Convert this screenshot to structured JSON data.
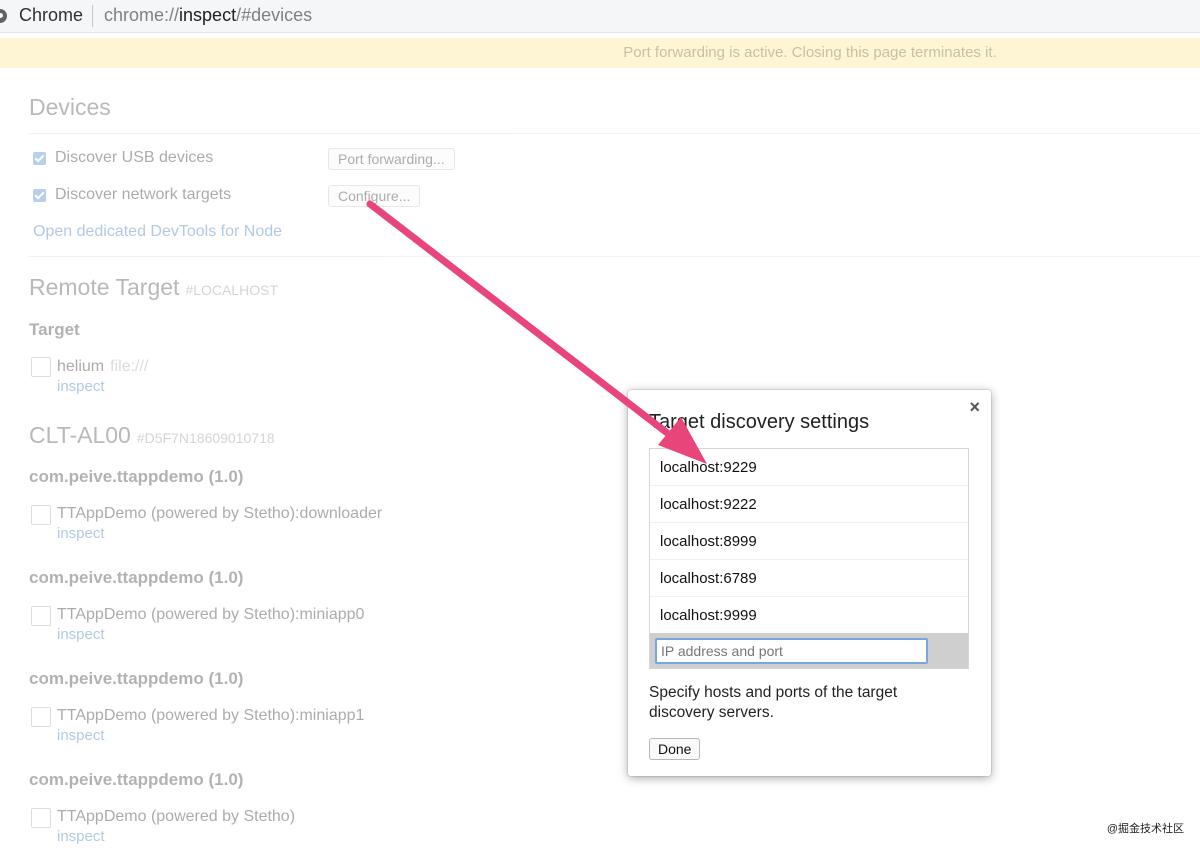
{
  "browser": {
    "name": "Chrome",
    "url_prefix": "chrome://",
    "url_host": "inspect",
    "url_path": "/#devices"
  },
  "banner": {
    "text": "Port forwarding is active. Closing this page terminates it."
  },
  "devices": {
    "title": "Devices",
    "discover_usb_label": "Discover USB devices",
    "port_forwarding_button": "Port forwarding...",
    "discover_network_label": "Discover network targets",
    "configure_button": "Configure...",
    "node_link": "Open dedicated DevTools for Node"
  },
  "remote_target": {
    "title": "Remote Target",
    "subtitle": "#LOCALHOST",
    "section_label": "Target",
    "target_name": "helium",
    "target_url": "file:///",
    "inspect_label": "inspect"
  },
  "device": {
    "title": "CLT-AL00",
    "serial": "#D5F7N18609010718",
    "apps": [
      {
        "package": "com.peive.ttappdemo (1.0)",
        "target": "TTAppDemo (powered by Stetho):downloader",
        "inspect": "inspect"
      },
      {
        "package": "com.peive.ttappdemo (1.0)",
        "target": "TTAppDemo (powered by Stetho):miniapp0",
        "inspect": "inspect"
      },
      {
        "package": "com.peive.ttappdemo (1.0)",
        "target": "TTAppDemo (powered by Stetho):miniapp1",
        "inspect": "inspect"
      },
      {
        "package": "com.peive.ttappdemo (1.0)",
        "target": "TTAppDemo (powered by Stetho)",
        "inspect": "inspect"
      }
    ]
  },
  "dialog": {
    "close_glyph": "×",
    "title": "Target discovery settings",
    "entries": [
      "localhost:9229",
      "localhost:9222",
      "localhost:8999",
      "localhost:6789",
      "localhost:9999"
    ],
    "input_placeholder": "IP address and port",
    "help_text": "Specify hosts and ports of the target discovery servers.",
    "done_button": "Done"
  },
  "annotation": {
    "arrow_color": "#e8457a"
  },
  "watermark": "@掘金技术社区"
}
